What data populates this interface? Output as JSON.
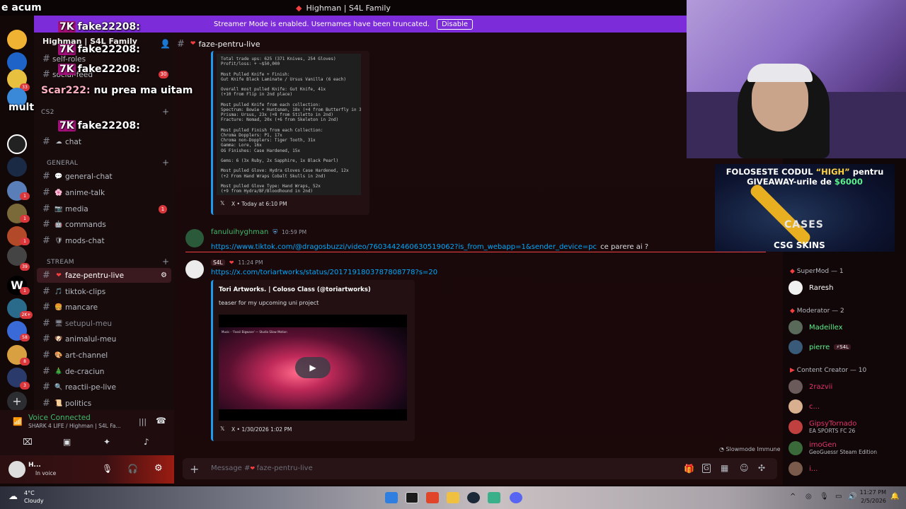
{
  "window": {
    "title": "Highman | S4L Family"
  },
  "streamer_mode": {
    "message": "Streamer Mode is enabled. Usernames have been truncated.",
    "disable_label": "Disable"
  },
  "overlay": {
    "top_text": "e acum",
    "line1_user": "fake22208:",
    "line2_user": "fake22208:",
    "line3_user": "fake22208:",
    "line4_user": "Scar222:",
    "line4_text": "nu prea ma uitam",
    "line4_cont": "mult",
    "line5_user": "fake22208:",
    "badge_30": "30"
  },
  "sidebar": {
    "server_name": "Highman | S4L Family",
    "top_channels": [
      "self-roles",
      "social-feed"
    ],
    "cat_cs2": "CS2",
    "chat_channel": "chat",
    "cat_general": "GENERAL",
    "general": [
      {
        "label": "general-chat",
        "emoji": "💬"
      },
      {
        "label": "anime-talk",
        "emoji": "🌸"
      },
      {
        "label": "media",
        "emoji": "📷",
        "unread": "1"
      },
      {
        "label": "commands",
        "emoji": "🤖"
      },
      {
        "label": "mods-chat",
        "emoji": "🛡"
      }
    ],
    "cat_stream": "STREAM",
    "stream": [
      {
        "label": "faze-pentru-live",
        "emoji": "❤"
      },
      {
        "label": "tiktok-clips",
        "emoji": "🎵"
      },
      {
        "label": "mancare",
        "emoji": "🍔"
      },
      {
        "label": "setupul-meu",
        "emoji": "🖥"
      },
      {
        "label": "animalul-meu",
        "emoji": "🐶"
      },
      {
        "label": "art-channel",
        "emoji": "🎨"
      },
      {
        "label": "de-craciun",
        "emoji": "🎄"
      },
      {
        "label": "reactii-pe-live",
        "emoji": "🔍"
      },
      {
        "label": "politics",
        "emoji": "📜"
      }
    ]
  },
  "servers": {
    "badges": [
      "33",
      "1",
      "1",
      "1",
      "39",
      "1",
      "2K+",
      "58",
      "8",
      "3"
    ]
  },
  "voice": {
    "title": "Voice Connected",
    "subtitle": "SHARK 4 LIFE / Highman | S4L Fa...",
    "user": "H...",
    "status": "In voice"
  },
  "chat": {
    "channel": "faze-pentru-live",
    "code_text": "Total trade ups: 625 (371 Knives, 254 Gloves)\nProfit/loss: + ~$50,000\n\nMost Pulled Knife + Finish:\nGut Knife Black Laminate / Ursus Vanilla (6 each)\n\nOverall most pulled Knife: Gut Knife, 41x\n(+10 from Flip in 2nd place)\n\nMost pulled Knife from each collection:\nSpectrum: Bowie + Huntsman, 18x (+4 from Butterfly in 3rd)\nPrisma: Ursus, 23x (+8 from Stiletto in 2nd)\nFracture: Nomad, 20x (+6 from Skeleton in 2nd)\n\nMost pulled Finish from each Collection:\nChroma Dopplers: P1, 17x\nChroma non-Dopplers: Tiger Tooth, 31x\nGamma: Lore, 16x\nOG Finishes: Case Hardened, 15x\n\nGems: 6 (3x Ruby, 2x Sapphire, 1x Black Pearl)\n\nMost pulled Glove: Hydra Gloves Case Hardened, 12x\n(+2 From Hand Wraps Cobalt Skulls in 2nd)\n\nMost pulled Glove Type: Hand Wraps, 52x\n(+9 from Hydra/BF/Bloodhound in 2nd)",
    "embed1_footer": "X • Today at 6:10 PM",
    "msg2_author": "fanuluihyghman",
    "msg2_time": "10:59 PM",
    "msg2_link": "https://www.tiktok.com/@dragosbuzzi/video/7603442460630519062?is_from_webapp=1&sender_device=pc",
    "msg2_text": "ce parere ai ?",
    "msg3_tag": "S4L",
    "msg3_time": "11:24 PM",
    "msg3_link": "https://x.com/toriartworks/status/2017191803787808778?s=20",
    "embed2_title": "Tori Artworks. | Coloso Class (@toriartworks)",
    "embed2_desc": "teaser for my upcoming uni project",
    "video_caption": "Music - 'Fossil Bigwave' — Studio Sliow Motion",
    "embed2_footer": "X • 1/30/2026 1:02 PM",
    "slowmode": "Slowmode Immune",
    "input_placeholder_prefix": "Message #",
    "input_placeholder_channel": "faze-pentru-live"
  },
  "promo": {
    "line1": "FOLOSESTE CODUL",
    "code": "“HIGH”",
    "line1b": "pentru",
    "line2": "GIVEAWAY-urile de",
    "amount": "$6000",
    "brand_top": "CASES",
    "brand": "CSG  SKINS"
  },
  "members": {
    "cat1": "SuperMod — 1",
    "supermod": [
      {
        "name": "Raresh",
        "color": "#ffffff"
      }
    ],
    "cat2": "Moderator — 2",
    "moderator": [
      {
        "name": "Madeillex",
        "color": "#5df08a"
      },
      {
        "name": "pierre",
        "tag": "⚡S4L",
        "color": "#5df08a"
      }
    ],
    "cat3": "Content Creator — 10",
    "creators": [
      {
        "name": "2razvii",
        "color": "#e0356b",
        "activity": ""
      },
      {
        "name": "c...",
        "color": "#e0356b",
        "activity": ""
      },
      {
        "name": "GipsyTornado",
        "color": "#e0356b",
        "activity": "EA SPORTS FC 26"
      },
      {
        "name": "imoGen",
        "color": "#e0356b",
        "activity": "GeoGuessr Steam Edition"
      },
      {
        "name": "i...",
        "color": "#e0356b",
        "activity": ""
      }
    ]
  },
  "taskbar": {
    "weather_temp": "4°C",
    "weather_desc": "Cloudy",
    "time": "11:27 PM",
    "date": "2/5/2026"
  },
  "colors": {
    "accent": "#7c2cd8",
    "link": "#00a8fc",
    "online": "#3fba6c",
    "danger": "#da373c"
  }
}
